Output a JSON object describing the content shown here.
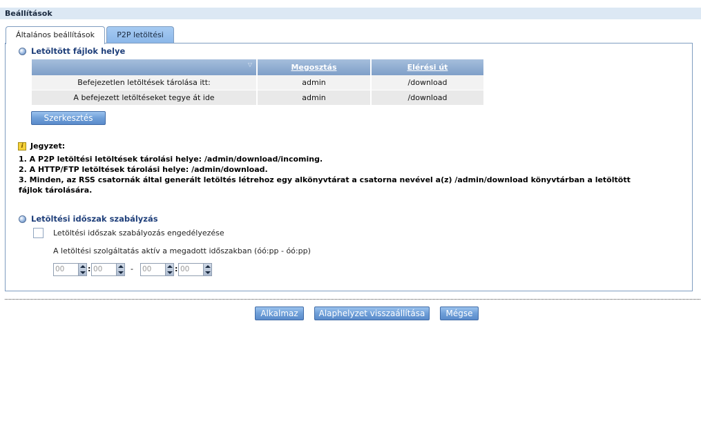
{
  "header": {
    "title": "Beállítások"
  },
  "tabs": [
    {
      "label": "Általános beállítások",
      "active": true
    },
    {
      "label": "P2P letöltési",
      "active": false
    }
  ],
  "files_section": {
    "title": "Letöltött fájlok helye",
    "columns": [
      "",
      "Megosztás",
      "Elérési út"
    ],
    "rows": [
      {
        "label": "Befejezetlen letöltések tárolása itt:",
        "share": "admin",
        "path": "/download"
      },
      {
        "label": "A befejezett letöltéseket tegye át ide",
        "share": "admin",
        "path": "/download"
      }
    ],
    "edit_button": "Szerkesztés"
  },
  "note": {
    "title": "Jegyzet:",
    "lines": [
      "1. A P2P letöltési letöltések tárolási helye: /admin/download/incoming.",
      "2. A HTTP/FTP letöltések tárolási helye: /admin/download.",
      "3. Minden, az RSS csatornák által generált letöltés létrehoz egy alkönyvtárat a csatorna nevével a(z) /admin/download könyvtárban a letöltött",
      "fájlok tárolására."
    ]
  },
  "schedule_section": {
    "title": "Letöltési időszak szabályzás",
    "checkbox_label": "Letöltési időszak szabályozás engedélyezése",
    "checkbox_checked": false,
    "description": "A letöltési szolgáltatás aktív a megadott időszakban (óó:pp - óó:pp)",
    "start_hour": "00",
    "start_minute": "00",
    "end_hour": "00",
    "end_minute": "00",
    "colon": ":",
    "dash": "-"
  },
  "footer": {
    "apply": "Alkalmaz",
    "reset": "Alaphelyzet visszaállítása",
    "cancel": "Mégse"
  }
}
